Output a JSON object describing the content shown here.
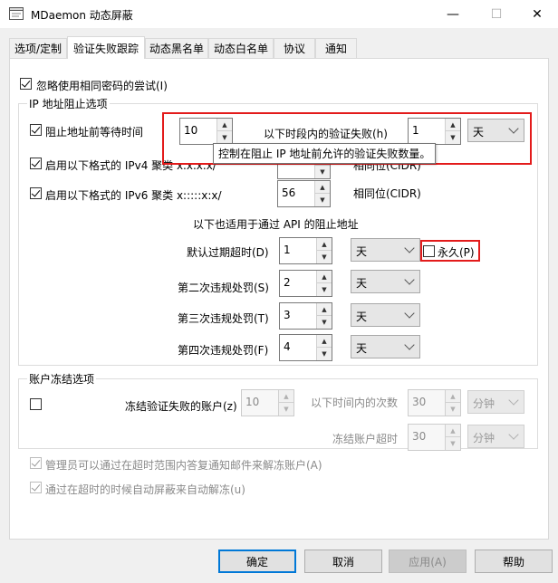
{
  "window": {
    "title": "MDaemon 动态屏蔽",
    "minimize_glyph": "—",
    "maximize_glyph": "☐",
    "close_glyph": "✕"
  },
  "tabs": [
    {
      "label": "选项/定制"
    },
    {
      "label": "验证失败跟踪"
    },
    {
      "label": "动态黑名单"
    },
    {
      "label": "动态白名单"
    },
    {
      "label": "协议"
    },
    {
      "label": "通知"
    }
  ],
  "ignore_same_password": {
    "label": "忽略使用相同密码的尝试(I)",
    "checked": true
  },
  "ip_group": {
    "title": "IP 地址阻止选项",
    "block_wait": {
      "label": "阻止地址前等待时间",
      "checked": true,
      "value": "10"
    },
    "failures_label": "以下时段内的验证失败(h)",
    "period_value": "1",
    "period_unit": "天",
    "tooltip": "控制在阻止 IP 地址前允许的验证失败数量。",
    "ipv4": {
      "label": "启用以下格式的 IPv4 聚类 x.x.x.x/",
      "checked": true,
      "value": "",
      "cidr_label": "相同位(CIDR)"
    },
    "ipv6": {
      "label": "启用以下格式的 IPv6 聚类 x:::::x:x/",
      "checked": true,
      "value": "56",
      "cidr_label": "相同位(CIDR)"
    },
    "api_note": "以下也适用于通过 API 的阻止地址",
    "default_expiry": {
      "label": "默认过期超时(D)",
      "value": "1",
      "unit": "天"
    },
    "permanent": {
      "label": "永久(P)",
      "checked": false
    },
    "second": {
      "label": "第二次违规处罚(S)",
      "value": "2",
      "unit": "天"
    },
    "third": {
      "label": "第三次违规处罚(T)",
      "value": "3",
      "unit": "天"
    },
    "fourth": {
      "label": "第四次违规处罚(F)",
      "value": "4",
      "unit": "天"
    }
  },
  "account_group": {
    "title": "账户冻结选项",
    "freeze_checked": false,
    "freeze_label": "冻结验证失败的账户(z)",
    "freeze_value": "10",
    "count_label": "以下时间内的次数",
    "count_value": "30",
    "count_unit": "分钟",
    "timeout_label": "冻结账户超时",
    "timeout_value": "30",
    "timeout_unit": "分钟",
    "admin_unfreeze": {
      "label": "管理员可以通过在超时范围内答复通知邮件来解冻账户(A)",
      "checked": true
    },
    "auto_unfreeze": {
      "label": "通过在超时的时候自动屏蔽来自动解冻(u)",
      "checked": true
    }
  },
  "buttons": {
    "ok": "确定",
    "cancel": "取消",
    "apply": "应用(A)",
    "help": "帮助"
  },
  "colors": {
    "accent": "#0078d7",
    "highlight": "#e31b1b"
  }
}
